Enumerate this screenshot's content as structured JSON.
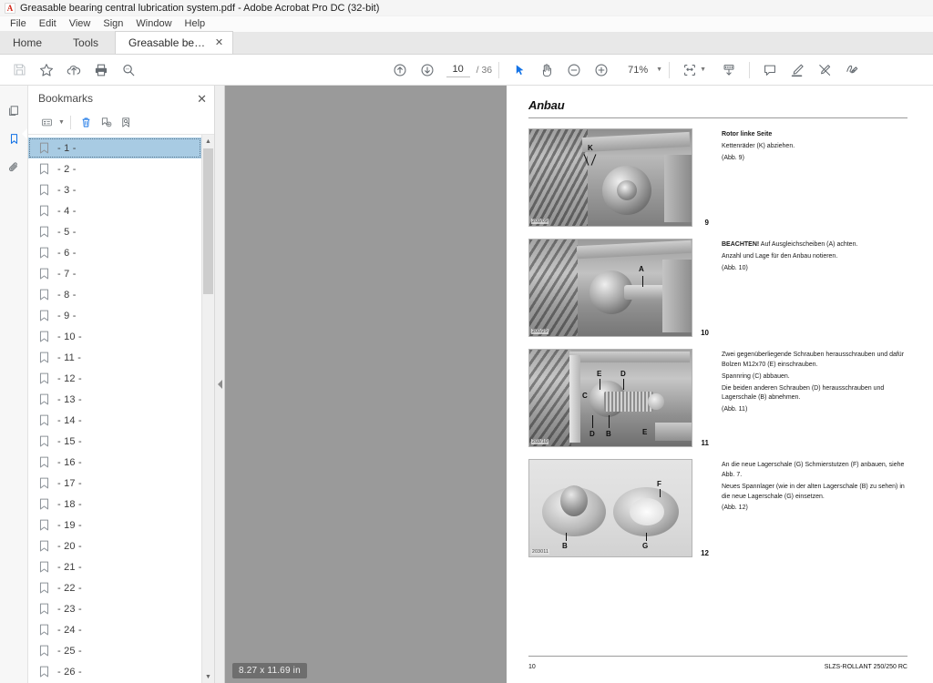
{
  "window": {
    "title": "Greasable bearing  central lubrication system.pdf - Adobe Acrobat Pro DC (32-bit)",
    "app_icon": "acrobat-logo-icon"
  },
  "menu": {
    "items": [
      {
        "label": "File"
      },
      {
        "label": "Edit"
      },
      {
        "label": "View"
      },
      {
        "label": "Sign"
      },
      {
        "label": "Window"
      },
      {
        "label": "Help"
      }
    ]
  },
  "tabs": {
    "home_label": "Home",
    "tools_label": "Tools",
    "document_label": "Greasable bearing  ...",
    "close_glyph": "✕"
  },
  "toolbar": {
    "save_label": "save-icon",
    "star_label": "add-to-favorites-icon",
    "upload_label": "upload-cloud-icon",
    "print_label": "print-icon",
    "search_label": "search-icon",
    "prev_page_label": "previous-page-icon",
    "next_page_label": "next-page-icon",
    "page_current": "10",
    "page_separator": "/",
    "page_total": "36",
    "select_tool_label": "select-cursor-icon",
    "hand_tool_label": "hand-tool-icon",
    "zoom_out_label": "zoom-out-icon",
    "zoom_in_label": "zoom-in-icon",
    "zoom_value": "71%",
    "zoom_caret": "▼",
    "fit_page_label": "fit-page-icon",
    "fit_caret": "▼",
    "scroll_mode_label": "scroll-mode-icon",
    "comment_label": "add-comment-icon",
    "highlight_label": "highlight-text-icon",
    "erase_label": "erase-icon",
    "sign_label": "fill-and-sign-icon"
  },
  "rail": {
    "thumbnails_label": "page-thumbnails-icon",
    "bookmarks_label": "bookmarks-icon",
    "attachments_label": "attachments-icon"
  },
  "bookmarks_panel": {
    "title": "Bookmarks",
    "close_glyph": "✕",
    "options_label": "bookmark-options-icon",
    "options_caret": "▼",
    "delete_label": "delete-bookmark-icon",
    "new_label": "new-bookmark-icon",
    "find_label": "find-bookmark-icon",
    "scroll_up_glyph": "▲",
    "scroll_down_glyph": "▼",
    "items": [
      {
        "label": "- 1 -",
        "selected": true
      },
      {
        "label": "- 2 -",
        "selected": false
      },
      {
        "label": "- 3 -",
        "selected": false
      },
      {
        "label": "- 4 -",
        "selected": false
      },
      {
        "label": "- 5 -",
        "selected": false
      },
      {
        "label": "- 6 -",
        "selected": false
      },
      {
        "label": "- 7 -",
        "selected": false
      },
      {
        "label": "- 8 -",
        "selected": false
      },
      {
        "label": "- 9 -",
        "selected": false
      },
      {
        "label": "- 10 -",
        "selected": false
      },
      {
        "label": "- 11 -",
        "selected": false
      },
      {
        "label": "- 12 -",
        "selected": false
      },
      {
        "label": "- 13 -",
        "selected": false
      },
      {
        "label": "- 14 -",
        "selected": false
      },
      {
        "label": "- 15 -",
        "selected": false
      },
      {
        "label": "- 16 -",
        "selected": false
      },
      {
        "label": "- 17 -",
        "selected": false
      },
      {
        "label": "- 18 -",
        "selected": false
      },
      {
        "label": "- 19 -",
        "selected": false
      },
      {
        "label": "- 20 -",
        "selected": false
      },
      {
        "label": "- 21 -",
        "selected": false
      },
      {
        "label": "- 22 -",
        "selected": false
      },
      {
        "label": "- 23 -",
        "selected": false
      },
      {
        "label": "- 24 -",
        "selected": false
      },
      {
        "label": "- 25 -",
        "selected": false
      },
      {
        "label": "- 26 -",
        "selected": false
      }
    ]
  },
  "splitter": {
    "collapse_glyph": "◀"
  },
  "viewer": {
    "page_size_tooltip": "8.27 x 11.69 in"
  },
  "document": {
    "heading": "Anbau",
    "figures": [
      {
        "id": "200/09",
        "number": "9",
        "image_labels": [
          "K"
        ],
        "paragraphs": [
          {
            "bold": "Rotor linke Seite",
            "text": ""
          },
          {
            "bold": "",
            "text": "Kettenräder (K) abziehen."
          },
          {
            "bold": "",
            "text": "(Abb. 9)"
          }
        ]
      },
      {
        "id": "200/29",
        "number": "10",
        "image_labels": [
          "A"
        ],
        "paragraphs": [
          {
            "bold": "BEACHTEN!",
            "text": " Auf Ausgleichscheiben (A) achten."
          },
          {
            "bold": "",
            "text": "Anzahl und Lage für den Anbau notieren."
          },
          {
            "bold": "",
            "text": "(Abb. 10)"
          }
        ]
      },
      {
        "id": "203/10",
        "number": "11",
        "image_labels": [
          "E",
          "D",
          "C",
          "D",
          "B",
          "E"
        ],
        "paragraphs": [
          {
            "bold": "",
            "text": "Zwei gegenüberliegende Schrauben herausschrauben und dafür Bolzen M12x70 (E) einschrauben."
          },
          {
            "bold": "",
            "text": "Spannring (C) abbauen."
          },
          {
            "bold": "",
            "text": "Die beiden anderen Schrauben (D) herausschrauben und Lagerschale (B) abnehmen."
          },
          {
            "bold": "",
            "text": "(Abb. 11)"
          }
        ]
      },
      {
        "id": "203011",
        "number": "12",
        "image_labels": [
          "F",
          "B",
          "G"
        ],
        "paragraphs": [
          {
            "bold": "",
            "text": "An die neue Lagerschale (G) Schmierstutzen (F) anbauen, siehe Abb. 7."
          },
          {
            "bold": "",
            "text": "Neues Spannlager (wie in der alten Lagerschale (B) zu sehen) in die neue Lagerschale (G) einsetzen."
          },
          {
            "bold": "",
            "text": "(Abb. 12)"
          }
        ]
      }
    ],
    "footer_page": "10",
    "footer_model": "SLZS-ROLLANT 250/250 RC"
  },
  "colors": {
    "accent_blue": "#1473e6",
    "selection_blue": "#a8cbe3",
    "viewer_gray": "#9a9a9a",
    "toolbar_icon": "#666c72"
  }
}
